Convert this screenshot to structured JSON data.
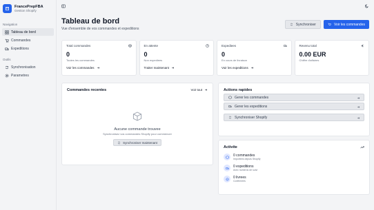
{
  "brand": {
    "name": "FrancePrepFBA",
    "subtitle": "Gestion Shopify"
  },
  "sidebar": {
    "section_nav": "Navigation",
    "nav": [
      {
        "label": "Tableau de bord",
        "icon": "grid-icon",
        "active": true
      },
      {
        "label": "Commandes",
        "icon": "cart-icon"
      },
      {
        "label": "Expeditions",
        "icon": "truck-icon"
      }
    ],
    "section_tools": "Outils",
    "tools": [
      {
        "label": "Synchronisation",
        "icon": "sync-icon"
      },
      {
        "label": "Parametres",
        "icon": "gear-icon"
      }
    ]
  },
  "header": {
    "title": "Tableau de bord",
    "subtitle": "Vue d'ensemble de vos commandes et expeditions",
    "sync_label": "Synchroniser",
    "orders_label": "Voir les commandes"
  },
  "stats": [
    {
      "label": "Total commandes",
      "value": "0",
      "caption": "Toutes les commandes",
      "link": "Voir les commandes",
      "icon": "box-icon"
    },
    {
      "label": "En attente",
      "value": "0",
      "caption": "Non expediees",
      "link": "Traiter maintenant",
      "icon": "clock-icon"
    },
    {
      "label": "Expediees",
      "value": "0",
      "caption": "En cours de livraison",
      "link": "Voir les expeditions",
      "icon": "truck-icon"
    },
    {
      "label": "Revenu total",
      "value": "0.00 EUR",
      "caption": "Chiffre d'affaires",
      "link": "",
      "icon": "euro-icon"
    }
  ],
  "recent": {
    "title": "Commandes recentes",
    "see_all": "Voir tout",
    "empty_title": "Aucune commande trouvee",
    "empty_sub": "Synchronisez vos commandes Shopify pour commencer",
    "sync_now": "Synchroniser maintenant"
  },
  "quick": {
    "title": "Actions rapides",
    "items": [
      {
        "label": "Gerer les commandes",
        "icon": "box-icon"
      },
      {
        "label": "Gerer les expeditions",
        "icon": "truck-icon"
      },
      {
        "label": "Synchroniser Shopify",
        "icon": "sync-icon"
      }
    ]
  },
  "activity": {
    "title": "Activite",
    "items": [
      {
        "title": "0 commandes",
        "sub": "Importees depuis Shopify",
        "icon": "box-icon"
      },
      {
        "title": "0 expeditions",
        "sub": "Avec numeros de suivi",
        "icon": "truck-icon"
      },
      {
        "title": "0 livrees",
        "sub": "Confirmees",
        "icon": "check-icon"
      }
    ]
  }
}
